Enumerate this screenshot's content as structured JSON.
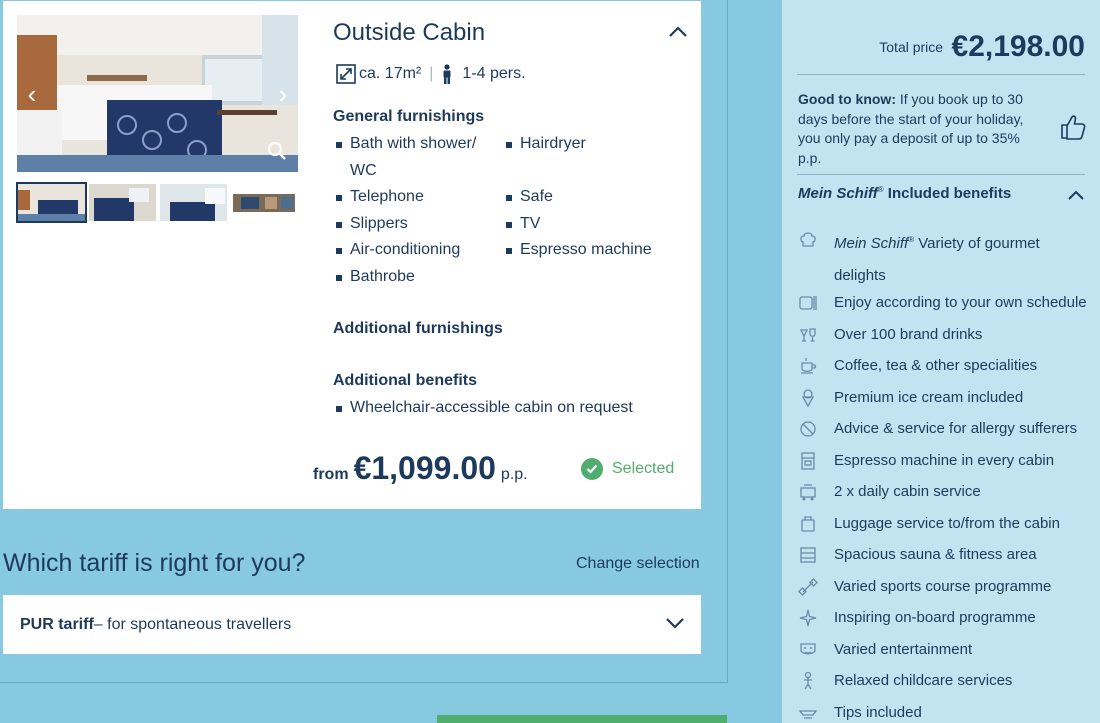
{
  "cabin": {
    "title": "Outside Cabin",
    "size": "ca. 17m²",
    "persons": "1-4 pers.",
    "general_heading": "General furnishings",
    "general_col1": [
      "Bath with shower/ WC",
      "Telephone",
      "Slippers",
      "Air-conditioning",
      "Bathrobe"
    ],
    "general_col2": [
      "Hairdryer",
      "Safe",
      "TV",
      "Espresso machine"
    ],
    "additional_heading": "Additional furnishings",
    "benefits_heading": "Additional benefits",
    "benefits": [
      "Wheelchair-accessible cabin on request"
    ],
    "price_from": "from",
    "price": "€1,099.00",
    "price_unit": "p.p.",
    "selected_label": "Selected"
  },
  "tariff": {
    "heading": "Which tariff is right for you?",
    "change_label": "Change selection",
    "name": "PUR tariff",
    "description": " – for spontaneous travellers"
  },
  "sidebar": {
    "total_label": "Total price",
    "total_value": "€2,198.00",
    "good_to_know_bold": "Good to know:",
    "good_to_know_text": " If you book up to 30 days before the start of your holiday, you only pay a deposit of up to 35% p.p.",
    "benefits_brand": "Mein Schiff",
    "benefits_reg": "®",
    "benefits_title": " Included benefits",
    "items": [
      {
        "icon": "chef-hat-icon",
        "brand": "Mein Schiff",
        "text": " Variety of gourmet delights"
      },
      {
        "icon": "dining-icon",
        "text": "Enjoy according to your own schedule"
      },
      {
        "icon": "drinks-icon",
        "text": "Over 100 brand drinks"
      },
      {
        "icon": "coffee-cup-icon",
        "text": "Coffee, tea & other specialities"
      },
      {
        "icon": "ice-cream-icon",
        "text": "Premium ice cream included"
      },
      {
        "icon": "allergy-icon",
        "text": "Advice & service for allergy sufferers"
      },
      {
        "icon": "espresso-machine-icon",
        "text": "Espresso machine in every cabin"
      },
      {
        "icon": "cabin-service-icon",
        "text": "2 x daily cabin service"
      },
      {
        "icon": "luggage-icon",
        "text": "Luggage service to/from the cabin"
      },
      {
        "icon": "sauna-icon",
        "text": "Spacious sauna & fitness area"
      },
      {
        "icon": "dumbbell-icon",
        "text": "Varied sports course programme"
      },
      {
        "icon": "sparkle-icon",
        "text": "Inspiring on-board programme"
      },
      {
        "icon": "theatre-mask-icon",
        "text": "Varied entertainment"
      },
      {
        "icon": "childcare-icon",
        "text": "Relaxed childcare services"
      },
      {
        "icon": "tips-icon",
        "text": "Tips included"
      }
    ]
  },
  "colors": {
    "navy": "#1d3a5c",
    "green": "#4fae6e",
    "sky": "#87c9e1",
    "panel": "#c1e4f0"
  }
}
